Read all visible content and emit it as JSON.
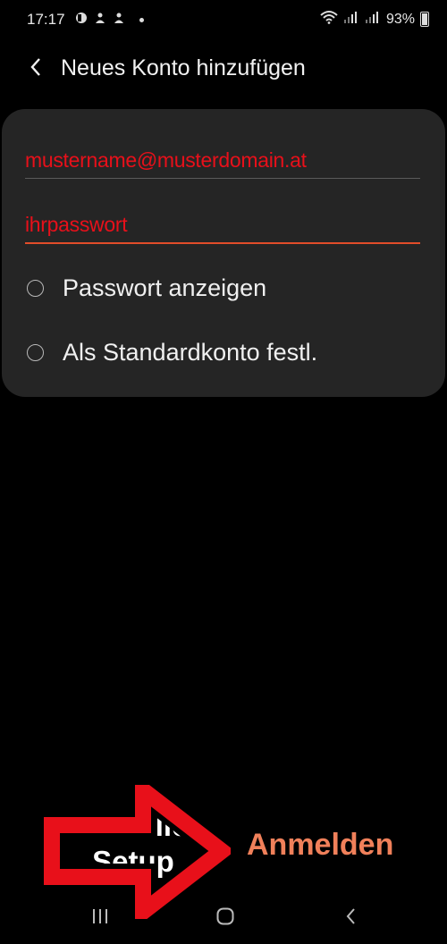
{
  "status_bar": {
    "time": "17:17",
    "battery": "93%"
  },
  "header": {
    "title": "Neues Konto hinzufügen"
  },
  "form": {
    "email_value": "mustername@musterdomain.at",
    "password_value": "ihrpasswort"
  },
  "options": [
    {
      "label": "Passwort anzeigen",
      "checked": false
    },
    {
      "label": "Als Standardkonto festl.",
      "checked": false
    }
  ],
  "footer": {
    "manual_setup_label": "Manuelles Setup",
    "login_label": "Anmelden"
  },
  "colors": {
    "accent": "#f0805a",
    "annotation_red": "#e8101a",
    "card_bg": "#252525"
  },
  "icons": [
    "back-arrow-icon",
    "recent-apps-icon",
    "home-icon",
    "nav-back-icon",
    "wifi-icon",
    "signal-icon",
    "battery-icon"
  ]
}
